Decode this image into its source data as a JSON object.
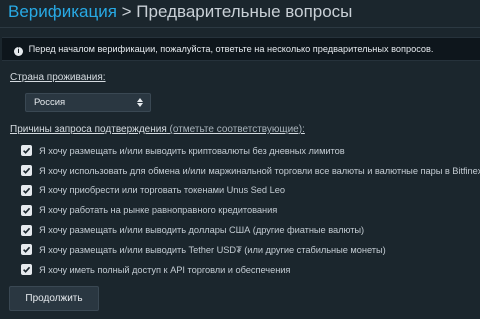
{
  "header": {
    "breadcrumb_link": "Верификация",
    "breadcrumb_rest": " > Предварительные вопросы"
  },
  "notice": {
    "text": "Перед началом верификации, пожалуйста, ответьте на несколько предварительных вопросов."
  },
  "country": {
    "label": "Страна проживания:",
    "selected": "Россия"
  },
  "reasons": {
    "label": "Причины запроса подтверждения",
    "hint": " (отметьте соответствующие):",
    "items": [
      {
        "label": "Я хочу размещать и/или выводить криптовалюты без дневных лимитов",
        "checked": true
      },
      {
        "label": "Я хочу использовать для обмена и/или маржинальной торговли все валюты и валютные пары в Bitfinex",
        "checked": true
      },
      {
        "label": "Я хочу приобрести или торговать токенами Unus Sed Leo",
        "checked": true
      },
      {
        "label": "Я хочу работать на рынке равноправного кредитования",
        "checked": true
      },
      {
        "label": "Я хочу размещать и/или выводить доллары США (другие фиатные валюты)",
        "checked": true
      },
      {
        "label": "Я хочу размещать и/или выводить Tether USD₮ (или другие стабильные монеты)",
        "checked": true
      },
      {
        "label": "Я хочу иметь полный доступ к API торговли и обеспечения",
        "checked": true
      }
    ]
  },
  "actions": {
    "continue_label": "Продолжить"
  },
  "colors": {
    "background": "#1b262d",
    "accent": "#28a9e4"
  }
}
